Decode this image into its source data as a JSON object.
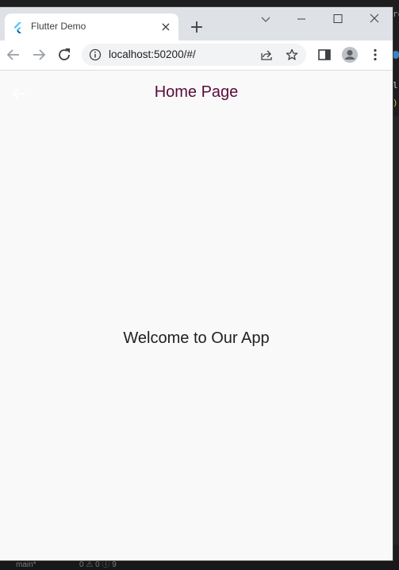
{
  "browser": {
    "tab_title": "Flutter Demo",
    "tab_close_glyph": "×",
    "new_tab_glyph": "+",
    "url": "localhost:50200/#/"
  },
  "app": {
    "appbar_title": "Home Page",
    "body_text": "Welcome to Our App",
    "title_color": "#5b0a3c"
  },
  "background_editor": {
    "status_branch": "main*",
    "status_problems": "0 ⚠ 0 ⓘ 9"
  },
  "icons": [
    "flutter-icon",
    "back-icon",
    "forward-icon",
    "reload-icon",
    "site-info-icon",
    "share-icon",
    "star-icon",
    "side-panel-icon",
    "profile-icon",
    "menu-icon",
    "tab-search-icon",
    "minimize-icon",
    "maximize-icon",
    "close-icon",
    "appbar-back-icon"
  ]
}
